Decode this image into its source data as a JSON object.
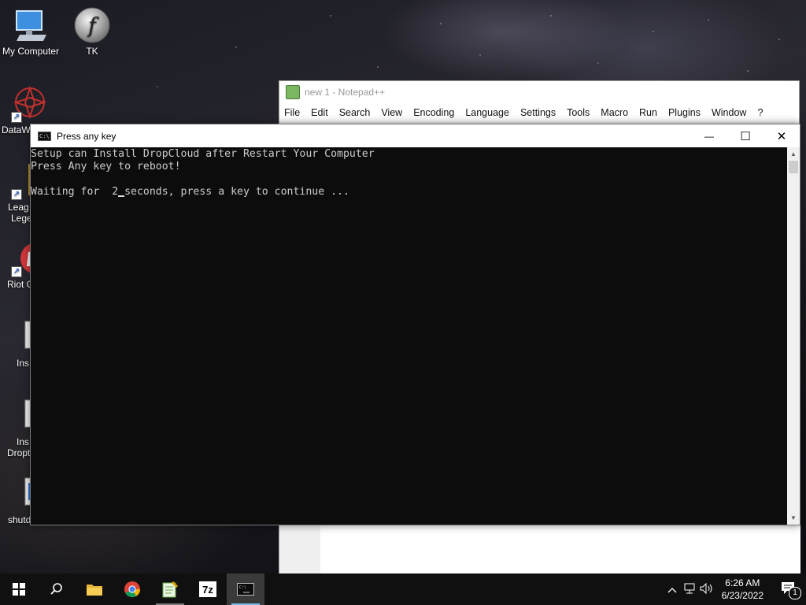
{
  "desktop": {
    "icons": [
      {
        "label": "My Computer",
        "icon": "computer-icon"
      },
      {
        "label": "TK",
        "icon": "flash-icon"
      },
      {
        "label": "DataW",
        "icon": "datawrapper-icon"
      },
      {
        "label": "Leag",
        "label2": "Lege",
        "icon": "league-icon"
      },
      {
        "label": "Riot C",
        "icon": "riot-client-icon"
      },
      {
        "label": "Ins",
        "icon": "installer-icon"
      },
      {
        "label": "Ins",
        "label2": "Dropt",
        "icon": "installer-icon"
      },
      {
        "label": "shutd",
        "icon": "shutdown-icon"
      }
    ]
  },
  "notepad": {
    "title": "new 1 - Notepad++",
    "menu": [
      "File",
      "Edit",
      "Search",
      "View",
      "Encoding",
      "Language",
      "Settings",
      "Tools",
      "Macro",
      "Run",
      "Plugins",
      "Window",
      "?"
    ]
  },
  "console": {
    "title": "Press any key",
    "lines": [
      "Setup can Install DropCloud after Restart Your Computer",
      "Press Any key to reboot!",
      "",
      "Waiting for  2 seconds, press a key to continue ..."
    ],
    "buttons": {
      "minimize": "—",
      "maximize": "☐",
      "close": "✕"
    }
  },
  "taskbar": {
    "items": [
      "start-icon",
      "search-icon",
      "file-explorer-icon",
      "chrome-icon",
      "notepad-plus-plus-icon",
      "7zip-icon",
      "console-icon"
    ],
    "time": "6:26 AM",
    "date": "6/23/2022",
    "notification_count": "1",
    "colors": {
      "accent": "#76b9ed"
    }
  }
}
